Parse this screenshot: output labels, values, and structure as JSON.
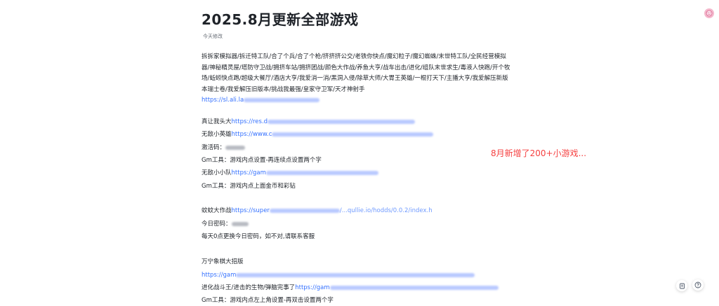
{
  "doc": {
    "title": "2025.8月更新全部游戏",
    "modified": "今天修改",
    "game_list": "拆拆家模拟器/拆迁特工队/合了个兵/合了个枪/挤挤挤公交/老铁你快点/魔幻粒子/魔幻蜘蛛/末世特工队/全民经营模拟器/神秘精灵屋/塔防守卫战/拥挤车站/拥挤团战/颜色大作战/养鱼大亨/战车出击/进化/组队末世求生/毒液人快跑/开个牧场/蚯蚓快点跑/超级大餐厅/酒店大亨/我爱消一消/黑洞入侵/除草大师/大胃王英雄/一棍打天下/主播大亨/我爱解压新版本瑞士卷/我爱解压旧版本/挑战我最强/皇家守卫军/天才神射手",
    "link1": "https://sl.ali.la",
    "game1": "真让我头大",
    "game1_link": "https://res.d",
    "game2": "无敌小英雄",
    "game2_link": "https://www.c",
    "activation_label": "激活码：",
    "gm1": "Gm工具：游戏内点设置-再连续点设置两个字",
    "game3": "无敌小小队",
    "game3_link": "https://gam",
    "gm2": "Gm工具：游戏内点上面金币和彩钻",
    "game4": "蚊蚊大作战",
    "game4_link": "https://super",
    "game4_link_tail": "/...qullie.io/hodds/0.0.2/index.h",
    "daily_pw_label": "今日密码：",
    "daily_note": "每天0点更换今日密码，如不对,请联系客服",
    "game5": "万宁象棋大招版",
    "game5_link": "https://gam",
    "game6": "进化战斗王/进击的生物/弹脑完事了",
    "game6_link": "https://gam",
    "gm3": "Gm工具：游戏内点左上角设置-再双击设置两个字"
  },
  "callout": "8月新增了200+小游戏...",
  "fab_icons": [
    "doc-icon",
    "help-icon"
  ],
  "colors": {
    "link": "#3370ff",
    "callout": "#f53f3f",
    "text": "#1f2329"
  }
}
